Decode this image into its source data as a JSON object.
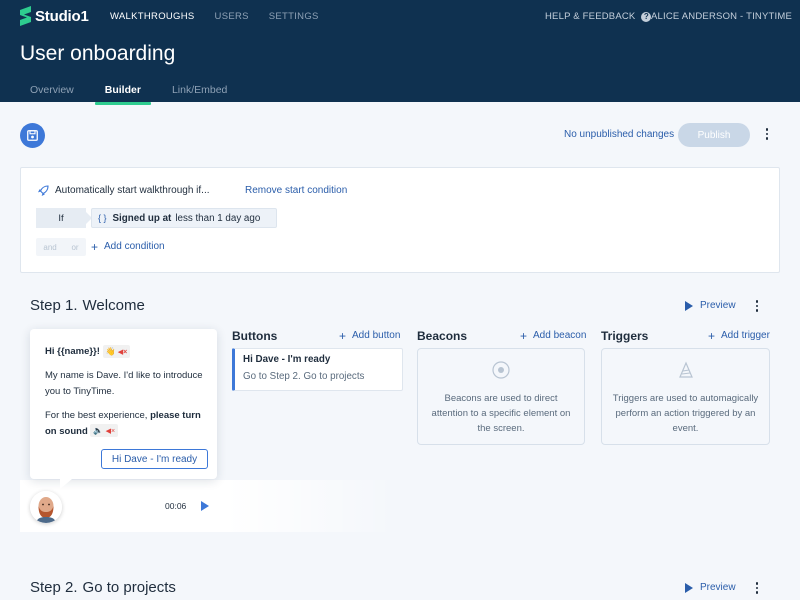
{
  "app": {
    "name": "Studio1"
  },
  "topnav": {
    "items": [
      "WALKTHROUGHS",
      "USERS",
      "SETTINGS"
    ],
    "active": "WALKTHROUGHS"
  },
  "help": {
    "label": "HELP & FEEDBACK"
  },
  "account": {
    "label": "ALICE ANDERSON - TINYTIME"
  },
  "page": {
    "title": "User onboarding"
  },
  "tabs": [
    "Overview",
    "Builder",
    "Link/Embed"
  ],
  "toolbar": {
    "status": "No unpublished changes",
    "publish_label": "Publish"
  },
  "condition": {
    "heading": "Automatically start walkthrough if...",
    "remove_label": "Remove start condition",
    "if_label": "If",
    "rule_property": "Signed up at",
    "rule_operator": "less than 1 day ago",
    "and_label": "and",
    "or_label": "or",
    "add_label": "Add condition"
  },
  "steps": [
    {
      "number_label": "Step 1.",
      "name": "Welcome",
      "preview_label": "Preview",
      "message": {
        "greeting": "Hi {{name}}!",
        "line1": "My name is Dave. I'd like to introduce you to TinyTime.",
        "line2_prefix": "For the best experience,",
        "line2_bold": "please turn on sound",
        "button_label": "Hi Dave - I'm ready",
        "duration": "00:06"
      },
      "buttons": {
        "title": "Buttons",
        "add_label": "Add button",
        "items": [
          {
            "label": "Hi Dave - I'm ready",
            "action": "Go to Step 2. Go to projects"
          }
        ]
      },
      "beacons": {
        "title": "Beacons",
        "add_label": "Add beacon",
        "empty_text": "Beacons are used to direct attention to a specific element on the screen."
      },
      "triggers": {
        "title": "Triggers",
        "add_label": "Add trigger",
        "empty_text": "Triggers are used to automagically perform an action triggered by an event."
      }
    },
    {
      "number_label": "Step 2.",
      "name": "Go to projects",
      "preview_label": "Preview"
    }
  ],
  "colors": {
    "header": "#0f3150",
    "accent": "#3d78d8",
    "tab_indicator": "#2ecc8f",
    "logo": "#2ecc8f"
  },
  "icons": [
    "logo-icon",
    "help-icon",
    "save-icon",
    "rocket-icon",
    "brace-icon",
    "plus-icon",
    "play-icon",
    "kebab-icon",
    "beacon-icon",
    "trigger-icon",
    "wave-emoji",
    "speaker-emoji",
    "mute-icon"
  ]
}
